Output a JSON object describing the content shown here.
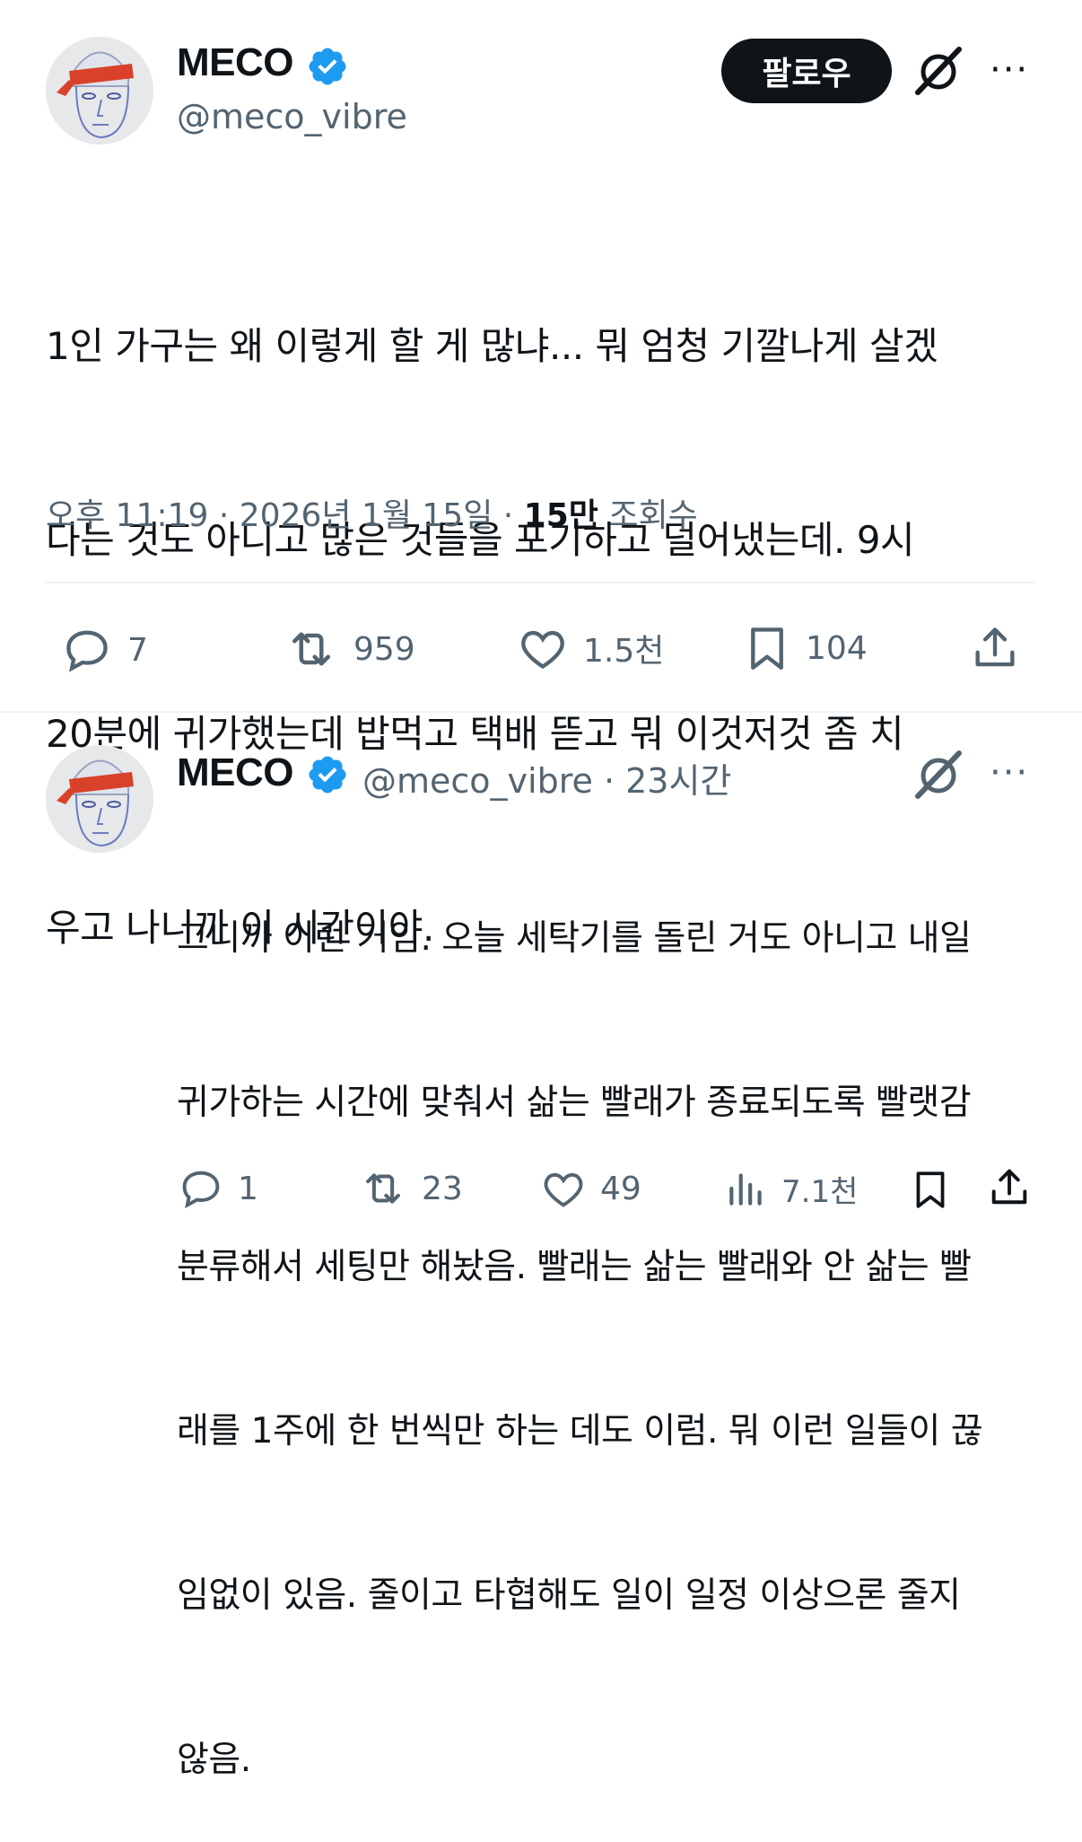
{
  "tweet": {
    "display_name": "MECO",
    "handle": "@meco_vibre",
    "follow_label": "팔로우",
    "more_label": "···",
    "lines": [
      "1인 가구는 왜 이렇게 할 게 많냐... 뭐 엄청 기깔나게 살겠",
      "다는 것도 아니고 많은 것들을 포기하고 덜어냈는데. 9시",
      "20분에 귀가했는데 밥먹고 택배 뜯고 뭐 이것저것 좀 치",
      "우고 나니까 이 시간이야."
    ],
    "timestamp": "오후 11:19 · 2026년 1월 15일 · ",
    "views_count": "15만",
    "views_label": " 조회수",
    "actions": {
      "replies": "7",
      "retweets": "959",
      "likes": "1.5천",
      "bookmarks": "104"
    }
  },
  "reply": {
    "display_name": "MECO",
    "handle_time": "@meco_vibre · 23시간",
    "more_label": "···",
    "lines": [
      "그니까 이런 거임. 오늘 세탁기를 돌린 거도 아니고 내일",
      "귀가하는 시간에 맞춰서 삶는 빨래가 종료되도록 빨랫감",
      "분류해서 세팅만 해놨음. 빨래는 삶는 빨래와 안 삶는 빨",
      "래를 1주에 한 번씩만 하는 데도 이럼. 뭐 이런 일들이 끊",
      "임없이 있음. 줄이고 타협해도 일이 일정 이상으론 줄지",
      "않음."
    ],
    "actions": {
      "replies": "1",
      "retweets": "23",
      "likes": "49",
      "views": "7.1천"
    }
  },
  "colors": {
    "text": "#0f1419",
    "secondary": "#536471",
    "verified": "#1d9bf0",
    "divider": "#eff3f4"
  }
}
